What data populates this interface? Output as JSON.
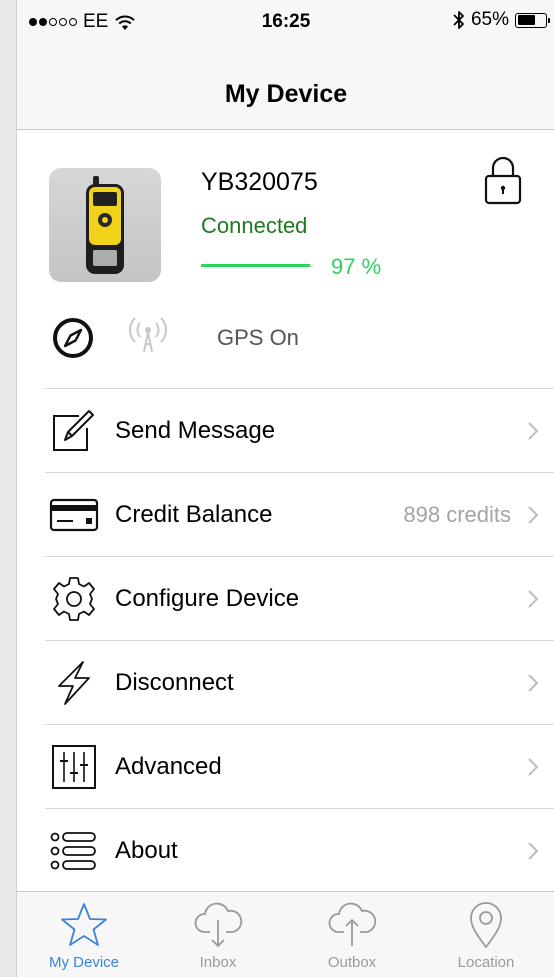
{
  "status_bar": {
    "carrier": "EE",
    "time": "16:25",
    "battery": "65%",
    "battery_level": 0.65,
    "signal_dots_filled": 2
  },
  "nav": {
    "title": "My Device"
  },
  "device": {
    "name": "YB320075",
    "status": "Connected",
    "battery_label": "97 %",
    "battery_level": 0.97,
    "gps_label": "GPS On"
  },
  "menu": [
    {
      "label": "Send Message",
      "value": "",
      "icon": "edit-icon"
    },
    {
      "label": "Credit Balance",
      "value": "898 credits",
      "icon": "credit-card-icon"
    },
    {
      "label": "Configure Device",
      "value": "",
      "icon": "gear-icon"
    },
    {
      "label": "Disconnect",
      "value": "",
      "icon": "lightning-icon"
    },
    {
      "label": "Advanced",
      "value": "",
      "icon": "sliders-icon"
    },
    {
      "label": "About",
      "value": "",
      "icon": "list-icon"
    }
  ],
  "tabs": [
    {
      "label": "My Device",
      "icon": "star-icon",
      "active": true
    },
    {
      "label": "Inbox",
      "icon": "cloud-download-icon",
      "active": false
    },
    {
      "label": "Outbox",
      "icon": "cloud-upload-icon",
      "active": false
    },
    {
      "label": "Location",
      "icon": "location-pin-icon",
      "active": false
    }
  ],
  "colors": {
    "accent": "#3b84d8",
    "connected": "#1f7a1f",
    "battery_green": "#2bd45a"
  }
}
